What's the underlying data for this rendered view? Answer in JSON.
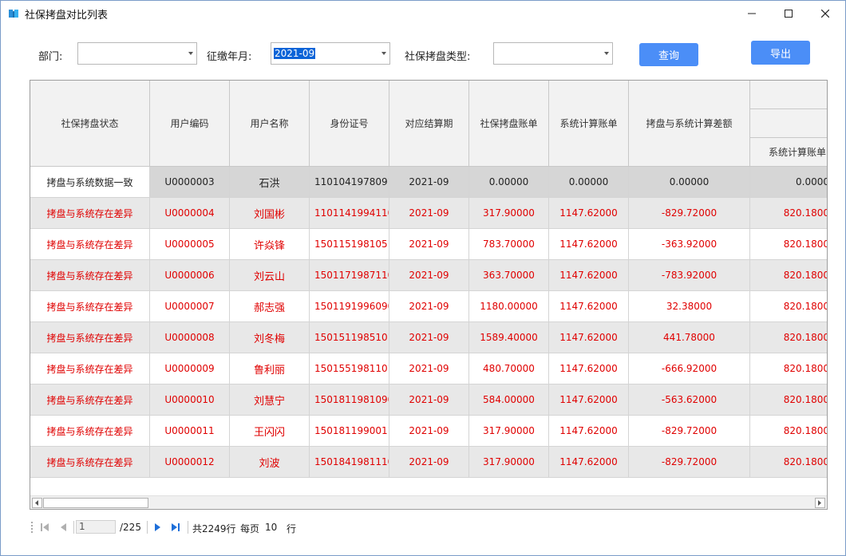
{
  "window": {
    "title": "社保拷盘对比列表"
  },
  "filters": {
    "dept_label": "部门:",
    "dept_value": "",
    "month_label": "征缴年月:",
    "month_value": "2021-09",
    "type_label": "社保拷盘类型:",
    "type_value": ""
  },
  "buttons": {
    "query": "查询",
    "export": "导出"
  },
  "table": {
    "columns": [
      "社保拷盘状态",
      "用户编码",
      "用户名称",
      "身份证号",
      "对应结算期",
      "社保拷盘账单",
      "系统计算账单",
      "拷盘与系统计算差额"
    ],
    "sub_header": "系统计算账单",
    "rows": [
      {
        "status": "拷盘与系统数据一致",
        "code": "U0000003",
        "name": "石洪",
        "id": "1101041978091...",
        "period": "2021-09",
        "bill": "0.00000",
        "sys": "0.00000",
        "diff": "0.00000",
        "extra": "0.0000"
      },
      {
        "status": "拷盘与系统存在差异",
        "code": "U0000004",
        "name": "刘国彬",
        "id": "1101141994110...",
        "period": "2021-09",
        "bill": "317.90000",
        "sys": "1147.62000",
        "diff": "-829.72000",
        "extra": "820.1800"
      },
      {
        "status": "拷盘与系统存在差异",
        "code": "U0000005",
        "name": "许焱锋",
        "id": "1501151981051...",
        "period": "2021-09",
        "bill": "783.70000",
        "sys": "1147.62000",
        "diff": "-363.92000",
        "extra": "820.1800"
      },
      {
        "status": "拷盘与系统存在差异",
        "code": "U0000006",
        "name": "刘云山",
        "id": "1501171987110...",
        "period": "2021-09",
        "bill": "363.70000",
        "sys": "1147.62000",
        "diff": "-783.92000",
        "extra": "820.1800"
      },
      {
        "status": "拷盘与系统存在差异",
        "code": "U0000007",
        "name": "郝志强",
        "id": "1501191996090...",
        "period": "2021-09",
        "bill": "1180.00000",
        "sys": "1147.62000",
        "diff": "32.38000",
        "extra": "820.1800"
      },
      {
        "status": "拷盘与系统存在差异",
        "code": "U0000008",
        "name": "刘冬梅",
        "id": "1501511985101...",
        "period": "2021-09",
        "bill": "1589.40000",
        "sys": "1147.62000",
        "diff": "441.78000",
        "extra": "820.1800"
      },
      {
        "status": "拷盘与系统存在差异",
        "code": "U0000009",
        "name": "鲁利丽",
        "id": "1501551981101...",
        "period": "2021-09",
        "bill": "480.70000",
        "sys": "1147.62000",
        "diff": "-666.92000",
        "extra": "820.1800"
      },
      {
        "status": "拷盘与系统存在差异",
        "code": "U0000010",
        "name": "刘慧宁",
        "id": "1501811981090...",
        "period": "2021-09",
        "bill": "584.00000",
        "sys": "1147.62000",
        "diff": "-563.62000",
        "extra": "820.1800"
      },
      {
        "status": "拷盘与系统存在差异",
        "code": "U0000011",
        "name": "王闪闪",
        "id": "1501811990011...",
        "period": "2021-09",
        "bill": "317.90000",
        "sys": "1147.62000",
        "diff": "-829.72000",
        "extra": "820.1800"
      },
      {
        "status": "拷盘与系统存在差异",
        "code": "U0000012",
        "name": "刘波",
        "id": "1501841981110...",
        "period": "2021-09",
        "bill": "317.90000",
        "sys": "1147.62000",
        "diff": "-829.72000",
        "extra": "820.1800"
      }
    ]
  },
  "pager": {
    "current_page": "1",
    "total_pages": "/225",
    "total_rows": "共2249行",
    "per_page_label": "每页",
    "per_page": "10",
    "rows_label": "行"
  },
  "colors": {
    "accent": "#4b8ef7",
    "diff_text": "#e00000",
    "row_alt": "#e8e8e8"
  }
}
